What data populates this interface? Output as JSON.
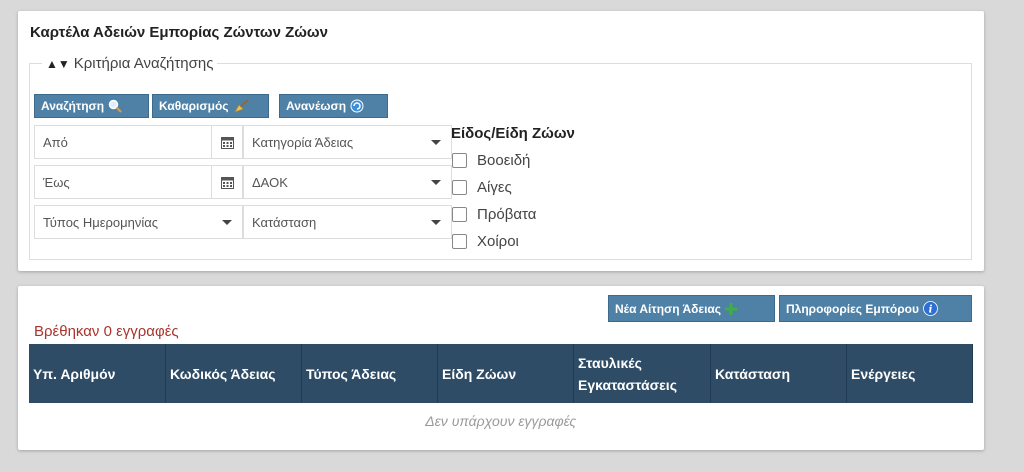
{
  "title": "Καρτέλα Αδειών Εμπορίας Ζώντων Ζώων",
  "criteria": {
    "legend_arrows": "▲▼",
    "legend": "Κριτήρια Αναζήτησης",
    "search_button": "Αναζήτηση",
    "clear_button": "Καθαρισμός",
    "refresh_button": "Ανανέωση",
    "from_placeholder": "Από",
    "to_placeholder": "Έως",
    "date_type": "Τύπος Ημερομηνίας",
    "license_category": "Κατηγορία Άδειας",
    "daok": "ΔΑΟΚ",
    "status": "Κατάσταση",
    "species_title": "Είδος/Είδη Ζώων",
    "species": [
      "Βοοειδή",
      "Αίγες",
      "Πρόβατα",
      "Χοίροι"
    ]
  },
  "results": {
    "new_request_button": "Νέα Αίτηση Άδειας",
    "merchant_info_button": "Πληροφορίες Εμπόρου",
    "found_text": "Βρέθηκαν 0 εγγραφές",
    "columns": [
      "Υπ. Αριθμόν",
      "Κωδικός Άδειας",
      "Τύπος Άδειας",
      "Είδη Ζώων",
      "Σταυλικές Εγκαταστάσεις",
      "Κατάσταση",
      "Ενέργειες"
    ],
    "empty_text": "Δεν υπάρχουν εγγραφές"
  },
  "colors": {
    "button_blue": "#4f81a7",
    "table_header": "#2e4c66",
    "found_text": "#a9342d"
  }
}
